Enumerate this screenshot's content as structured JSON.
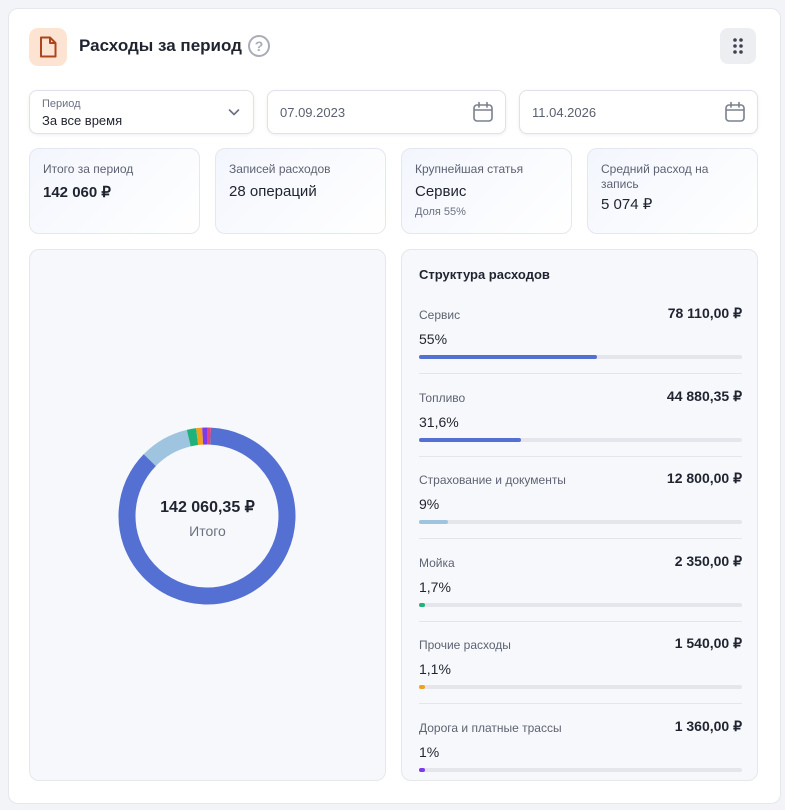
{
  "header": {
    "title": "Расходы за период",
    "help": "?"
  },
  "filters": {
    "period_label": "Период",
    "period_value": "За все время",
    "date_from": "07.09.2023",
    "date_to": "11.04.2026"
  },
  "stats": [
    {
      "label": "Итого за период",
      "value": "142 060 ₽"
    },
    {
      "label": "Записей расходов",
      "value": "28 операций"
    },
    {
      "label": "Крупнейшая статья",
      "value": "Сервис",
      "sub": "Доля 55%"
    },
    {
      "label": "Средний расход на запись",
      "value": "5 074 ₽"
    }
  ],
  "donut": {
    "total": "142 060,35 ₽",
    "caption": "Итого"
  },
  "structure": {
    "title": "Структура расходов",
    "items": [
      {
        "name": "Сервис",
        "amount": "78 110,00 ₽",
        "percent": "55%",
        "share": 0.55,
        "color": "#5470d2"
      },
      {
        "name": "Топливо",
        "amount": "44 880,35 ₽",
        "percent": "31,6%",
        "share": 0.316,
        "color": "#5470d2"
      },
      {
        "name": "Страхование и документы",
        "amount": "12 800,00 ₽",
        "percent": "9%",
        "share": 0.09,
        "color": "#9fc4e0"
      },
      {
        "name": "Мойка",
        "amount": "2 350,00 ₽",
        "percent": "1,7%",
        "share": 0.017,
        "color": "#1fb27a"
      },
      {
        "name": "Прочие расходы",
        "amount": "1 540,00 ₽",
        "percent": "1,1%",
        "share": 0.011,
        "color": "#f0a21f"
      },
      {
        "name": "Дорога и платные трассы",
        "amount": "1 360,00 ₽",
        "percent": "1%",
        "share": 0.01,
        "color": "#7c3aed"
      }
    ]
  },
  "donut_segments": [
    {
      "name": "Сервис + Топливо",
      "share": 0.866,
      "color": "#5470d2"
    },
    {
      "name": "Страхование и документы",
      "share": 0.09,
      "color": "#9fc4e0"
    },
    {
      "name": "Мойка",
      "share": 0.017,
      "color": "#1fb27a"
    },
    {
      "name": "Прочие расходы",
      "share": 0.011,
      "color": "#f0a21f"
    },
    {
      "name": "Дорога и платные трассы",
      "share": 0.01,
      "color": "#7c3aed"
    },
    {
      "name": "Прочее",
      "share": 0.006,
      "color": "#e0457b"
    }
  ]
}
